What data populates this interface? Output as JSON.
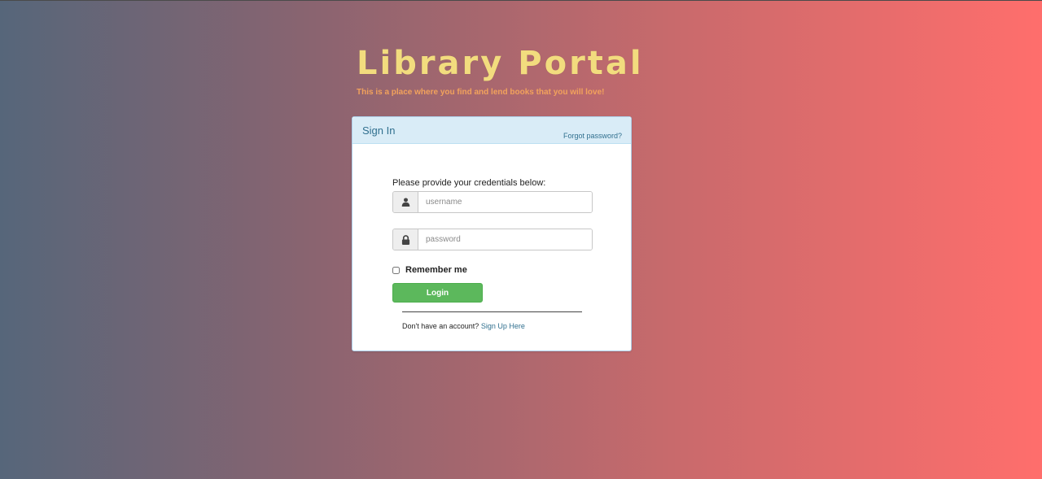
{
  "hero": {
    "title": "Library Portal",
    "tagline": "This is a place where you find and lend books that you will love!"
  },
  "panel": {
    "title": "Sign In",
    "forgot_password": "Forgot password?",
    "instructions": "Please provide your credentials below:",
    "username": {
      "value": "",
      "placeholder": "username",
      "icon": "user-icon"
    },
    "password": {
      "value": "",
      "placeholder": "password",
      "icon": "lock-icon"
    },
    "remember_label": "Remember me",
    "remember_checked": false,
    "login_label": "Login",
    "signup_prompt": "Don't have an account?",
    "signup_link": "Sign Up Here"
  },
  "colors": {
    "title": "#f2dc7e",
    "tagline": "#f2a25c",
    "login_button": "#5cb85c",
    "link": "#31708f",
    "panel_heading": "#d9ecf7"
  }
}
